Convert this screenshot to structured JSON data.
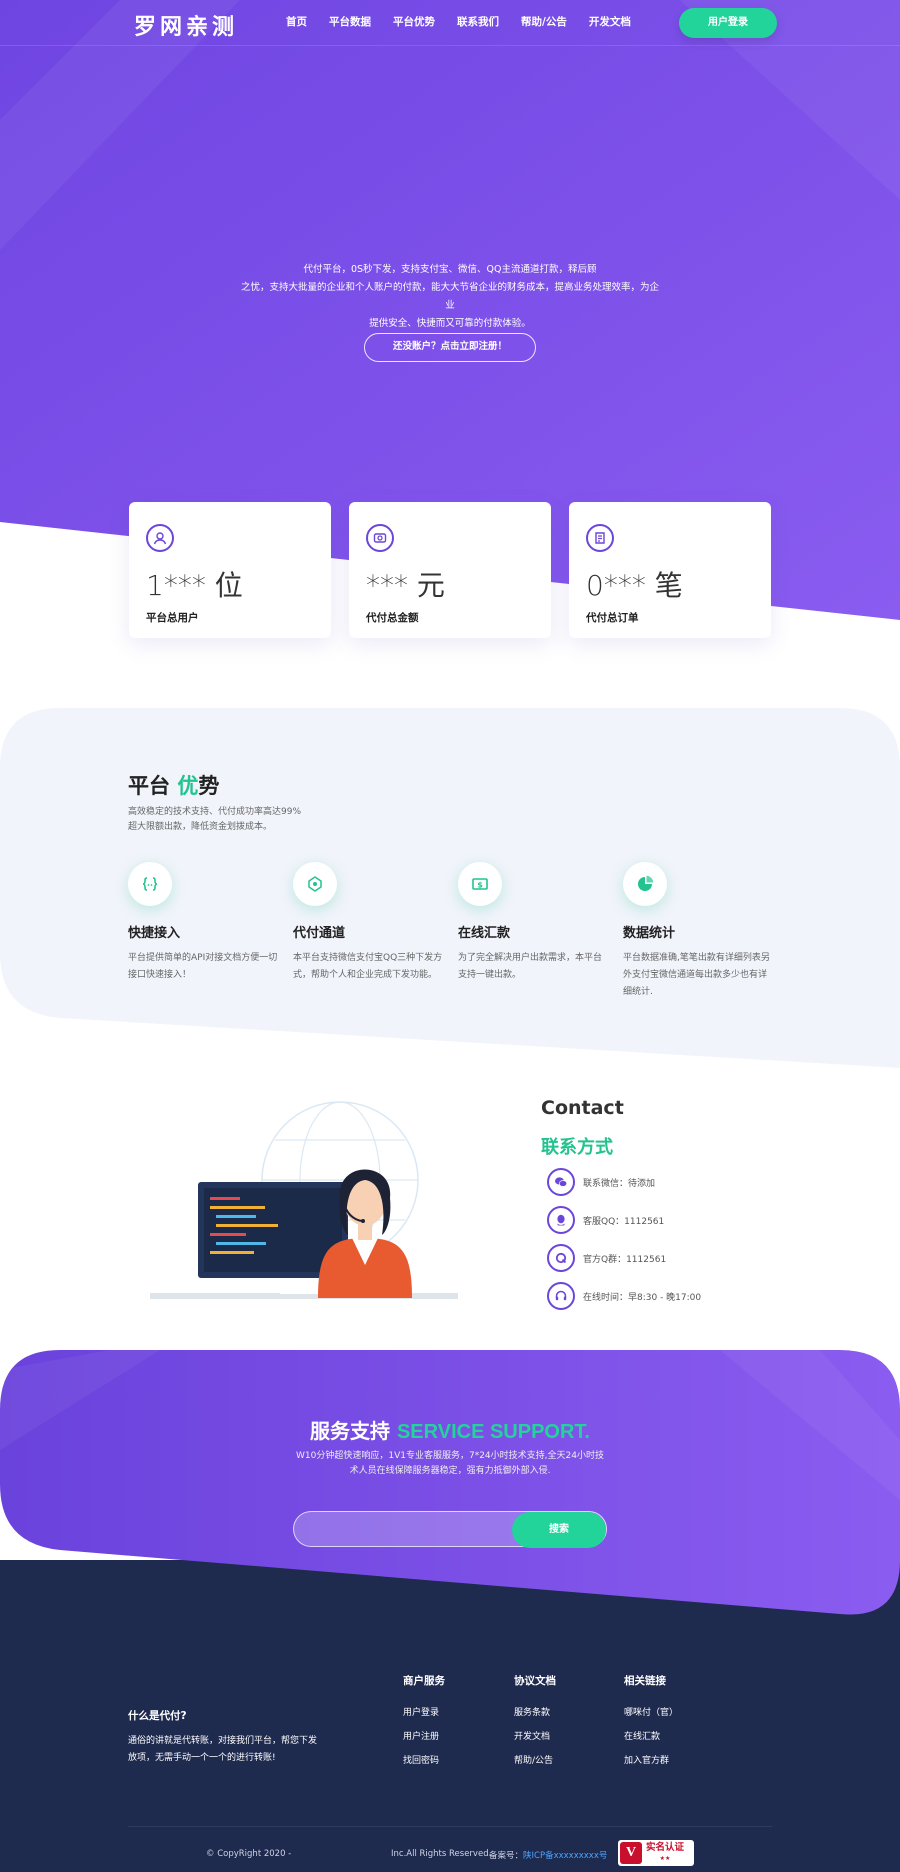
{
  "colors": {
    "purple": "#7548e6",
    "purple_light": "#8b5cf0",
    "green": "#22d39a",
    "navy": "#1f2a4f"
  },
  "nav": {
    "logo": "罗网亲测",
    "items": [
      "首页",
      "平台数据",
      "平台优势",
      "联系我们",
      "帮助/公告",
      "开发文档"
    ],
    "login_label": "用户登录"
  },
  "hero": {
    "line1": "代付平台，0S秒下发，支持支付宝、微信、QQ主流通道打款，释后顾",
    "line2": "之忧，支持大批量的企业和个人账户的付款，能大大节省企业的财务成本，提高业务处理效率，为企业",
    "line3": "提供安全、快捷而又可靠的付款体验。",
    "register_label": "还没账户？点击立即注册！"
  },
  "stats": [
    {
      "icon": "users-icon",
      "value": "1*** 位",
      "label": "平台总用户"
    },
    {
      "icon": "money-icon",
      "value": "*** 元",
      "label": "代付总金额"
    },
    {
      "icon": "orders-icon",
      "value": "0*** 笔",
      "label": "代付总订单"
    }
  ],
  "advantage": {
    "title_a": "平台",
    "title_hl": "优",
    "title_b": "势",
    "sub1": "高效稳定的技术支持、代付成功率高达99%",
    "sub2": "超大限额出款，降低资金划拨成本。",
    "features": [
      {
        "icon": "code-icon",
        "title": "快捷接入",
        "desc": "平台提供简单的API对接文档方便一切接口快速接入！"
      },
      {
        "icon": "network-icon",
        "title": "代付通道",
        "desc": "本平台支持微信支付宝QQ三种下发方式，帮助个人和企业完成下发功能。"
      },
      {
        "icon": "cash-icon",
        "title": "在线汇款",
        "desc": "为了完全解决用户出款需求，本平台支持一键出款。"
      },
      {
        "icon": "pie-chart-icon",
        "title": "数据统计",
        "desc": "平台数据准确,笔笔出款有详细列表另外支付宝微信通道每出款多少也有详细统计."
      }
    ]
  },
  "contact": {
    "heading": "Contact",
    "subheading": "联系方式",
    "items": [
      {
        "icon": "wechat-icon",
        "text": "联系微信：待添加"
      },
      {
        "icon": "qq-icon",
        "text": "客服QQ：1112561"
      },
      {
        "icon": "qq-group-icon",
        "text": "官方Q群：1112561"
      },
      {
        "icon": "headset-icon",
        "text": "在线时间：早8:30 - 晚17:00"
      }
    ]
  },
  "service": {
    "title_cn": "服务支持",
    "title_en": "SERVICE SUPPORT.",
    "desc1": "W10分钟超快速响应，1V1专业客服服务，7*24小时技术支持,全天24小时技",
    "desc2": "术人员在线保障服务器稳定，强有力抵御外部入侵.",
    "search_placeholder": "",
    "search_label": "搜索"
  },
  "footer": {
    "about_title": "什么是代付?",
    "about_text": "通俗的讲就是代转账，对接我们平台，帮您下发放项，无需手动一个一个的进行转账!",
    "columns": [
      {
        "title": "商户服务",
        "links": [
          "用户登录",
          "用户注册",
          "找回密码"
        ]
      },
      {
        "title": "协议文档",
        "links": [
          "服务条款",
          "开发文档",
          "帮助/公告"
        ]
      },
      {
        "title": "相关链接",
        "links": [
          "哪咪付（官）",
          "在线汇款",
          "加入官方群"
        ]
      }
    ],
    "copyright": "© CopyRight 2020 -",
    "rights": "Inc.All Rights Reserved.",
    "icp_label": "备案号：",
    "icp_value": "陕ICP备xxxxxxxxx号",
    "badge_text": "实名认证",
    "badge_sub": "★★"
  }
}
